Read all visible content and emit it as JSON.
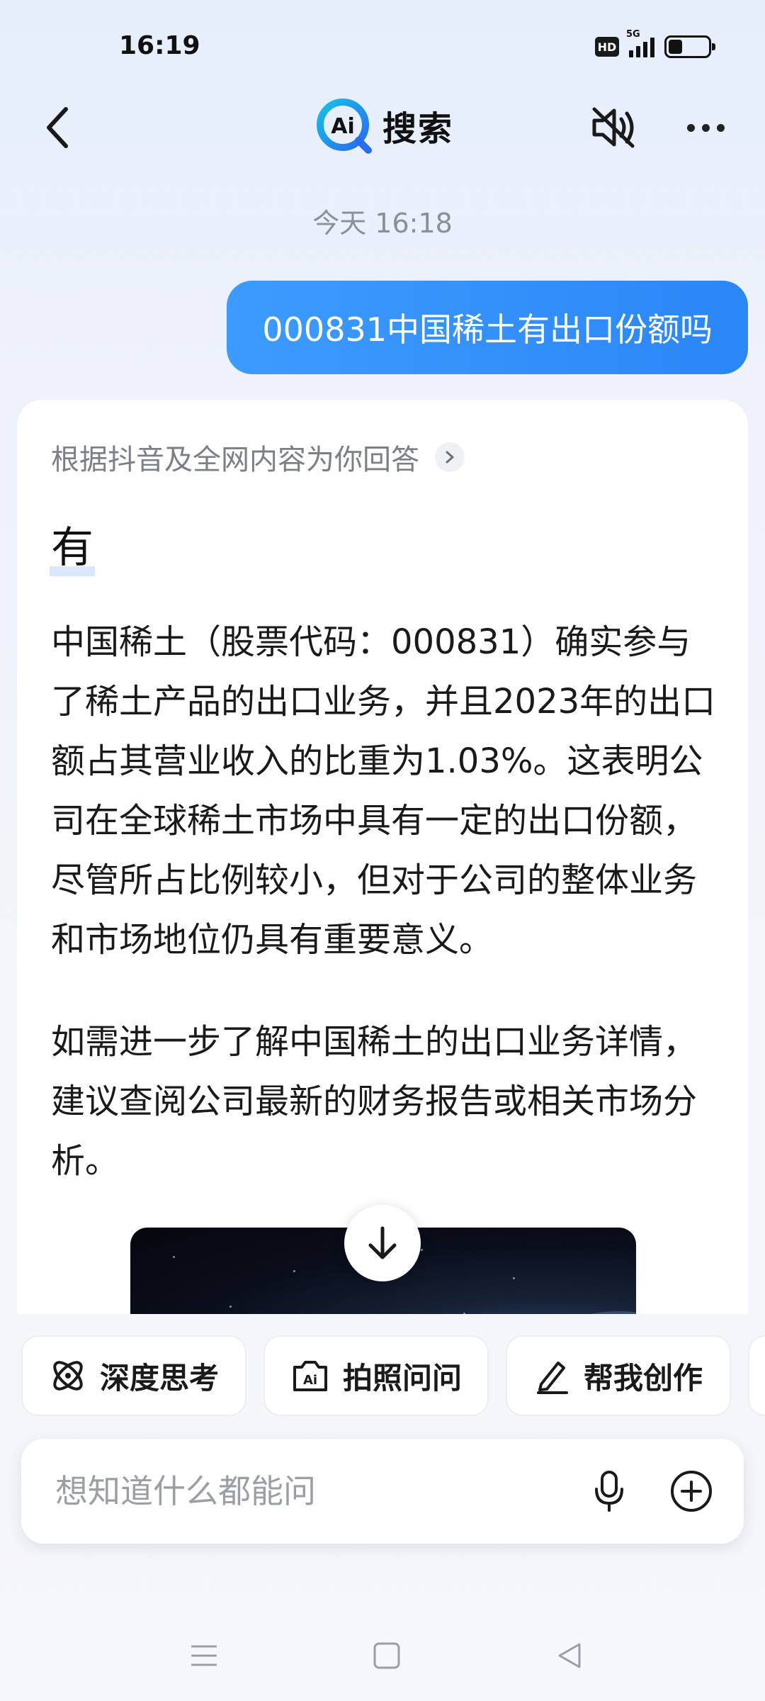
{
  "status_bar": {
    "time": "16:19",
    "hd_label": "HD",
    "network_label": "5G",
    "battery_level": 0.36
  },
  "header": {
    "logo_mark_text": "Ai",
    "title": "搜索",
    "icons": {
      "back": "back-arrow-icon",
      "mute": "speaker-muted-icon",
      "more": "more-horizontal-icon"
    }
  },
  "chat": {
    "timestamp": "今天 16:18",
    "user_message": "000831中国稀土有出口份额吗",
    "answer": {
      "source_note": "根据抖音及全网内容为你回答",
      "headline": "有",
      "paragraphs": [
        "中国稀土（股票代码：000831）确实参与了稀土产品的出口业务，并且2023年的出口额占其营业收入的比重为1.03%。这表明公司在全球稀土市场中具有一定的出口份额，尽管所占比例较小，但对于公司的整体业务和市场地位仍具有重要意义。",
        "如需进一步了解中国稀土的出口业务详情，建议查阅公司最新的财务报告或相关市场分析。"
      ]
    }
  },
  "quick_actions": [
    {
      "label": "深度思考",
      "icon": "atom-icon"
    },
    {
      "label": "拍照问问",
      "icon": "camera-ai-icon"
    },
    {
      "label": "帮我创作",
      "icon": "pen-icon"
    }
  ],
  "input": {
    "placeholder": "想知道什么都能问",
    "value": ""
  },
  "colors": {
    "accent": "#2b86f6",
    "bubble_start": "#3d9bff",
    "logo_cyan": "#16c0e6",
    "logo_blue": "#2a6cf0"
  }
}
